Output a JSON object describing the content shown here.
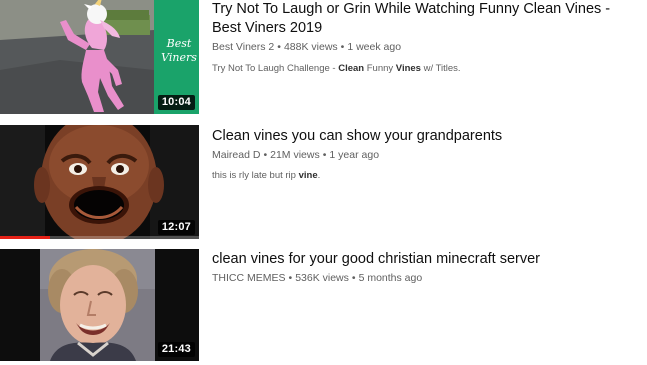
{
  "results": [
    {
      "title": "Try Not To Laugh or Grin While Watching Funny Clean Vines - Best Viners 2019",
      "channel": "Best Viners 2",
      "views": "488K views",
      "age": "1 week ago",
      "duration": "10:04",
      "thumb_overlay": "Best Viners",
      "desc_parts": [
        "Try Not To Laugh Challenge - ",
        "Clean",
        " Funny ",
        "Vines",
        " w/ Titles."
      ],
      "progress_fraction": 0
    },
    {
      "title": "Clean vines you can show your grandparents",
      "channel": "Mairead D",
      "views": "21M views",
      "age": "1 year ago",
      "duration": "12:07",
      "desc_parts": [
        "this is rly late but rip ",
        "vine",
        "."
      ],
      "progress_fraction": 0.25
    },
    {
      "title": "clean vines for your good christian minecraft server",
      "channel": "THICC MEMES",
      "views": "536K views",
      "age": "5 months ago",
      "duration": "21:43",
      "progress_fraction": 0
    }
  ],
  "separator": "•",
  "colors": {
    "progress": "#e62117",
    "title": "#0f0f0f",
    "meta": "#606060",
    "thumb1_bg": "#1aa36a"
  },
  "icons": [
    "unicorn-costume-thumbnail",
    "screaming-face-thumbnail",
    "smiling-woman-thumbnail"
  ]
}
